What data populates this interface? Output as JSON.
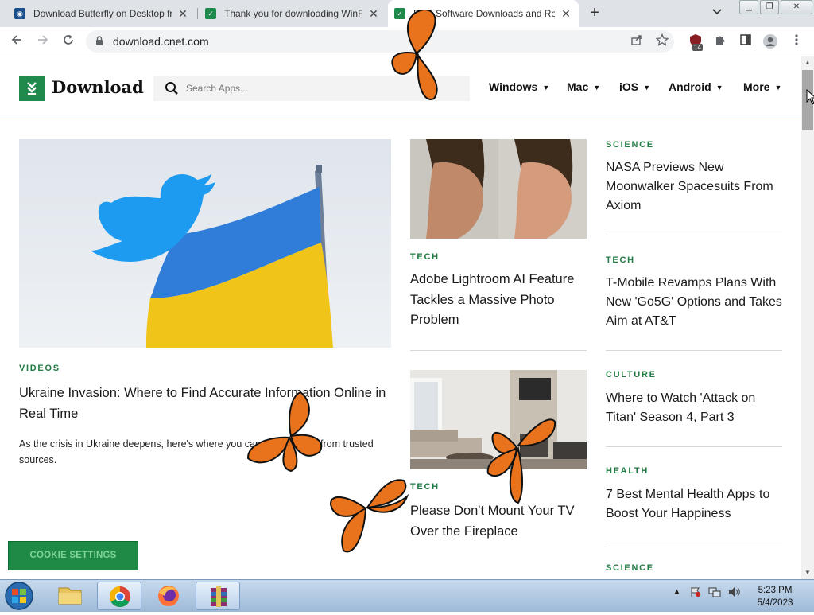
{
  "browser": {
    "tabs": [
      {
        "title": "Download Butterfly on Desktop fr",
        "favicon_color": "#1a4f8b"
      },
      {
        "title": "Thank you for downloading WinR",
        "favicon_color": "#1f8a4c"
      },
      {
        "title": "Free Software Downloads and Re",
        "favicon_color": "#1f8a4c",
        "active": true
      }
    ],
    "close_glyph": "✕",
    "new_tab_glyph": "+",
    "url": "download.cnet.com",
    "extension_badge": "14"
  },
  "site": {
    "logo_text": "Download",
    "search_placeholder": "Search Apps...",
    "nav": [
      "Windows",
      "Mac",
      "iOS",
      "Android",
      "More"
    ],
    "feature": {
      "kicker": "VIDEOS",
      "headline": "Ukraine Invasion: Where to Find Accurate Information Online in Real Time",
      "desc": "As the crisis in Ukraine deepens, here's where you can find updates from trusted sources."
    },
    "middle": [
      {
        "kicker": "TECH",
        "headline": "Adobe Lightroom AI Feature Tackles a Massive Photo Problem"
      },
      {
        "kicker": "TECH",
        "headline": "Please Don't Mount Your TV Over the Fireplace"
      }
    ],
    "right": [
      {
        "kicker": "SCIENCE",
        "headline": "NASA Previews New Moonwalker Spacesuits From Axiom"
      },
      {
        "kicker": "TECH",
        "headline": "T-Mobile Revamps Plans With New 'Go5G' Options and Takes Aim at AT&T"
      },
      {
        "kicker": "CULTURE",
        "headline": "Where to Watch 'Attack on Titan' Season 4, Part 3"
      },
      {
        "kicker": "HEALTH",
        "headline": "7 Best Mental Health Apps to Boost Your Happiness"
      },
      {
        "kicker": "SCIENCE",
        "headline": ""
      }
    ],
    "cookie_button": "COOKIE SETTINGS"
  },
  "taskbar": {
    "time": "5:23 PM",
    "date": "5/4/2023"
  },
  "colors": {
    "brand_green": "#1f8a4c",
    "kicker_green": "#1f7a43",
    "butterfly_orange": "#e8731c"
  }
}
